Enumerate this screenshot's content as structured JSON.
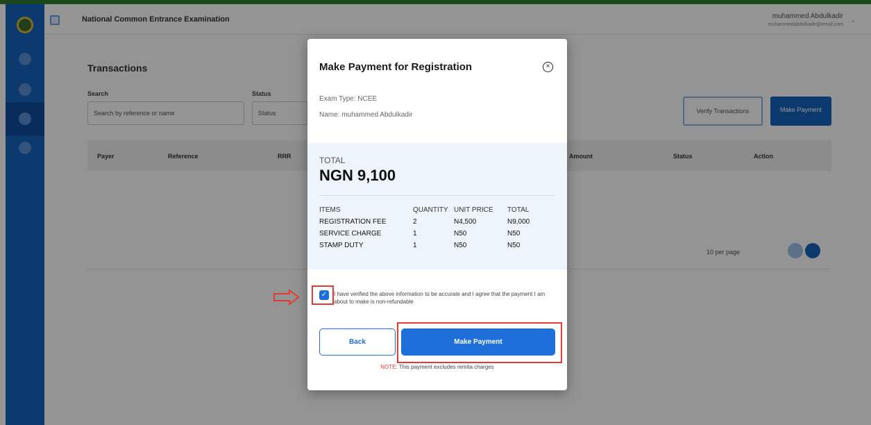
{
  "header": {
    "app_title": "National Common Entrance Examination",
    "user_name": "muhammed Abdulkadir",
    "user_email": "muhammedabdulkadir@email.com"
  },
  "page": {
    "title": "Transactions",
    "search_label": "Search",
    "search_placeholder": "Search by reference or name",
    "status_label": "Status",
    "status_value": "Status",
    "outline_button": "Verify Transactions",
    "primary_button": "Make Payment",
    "table_columns": [
      "Payer",
      "Reference",
      "RRR",
      "Amount",
      "Status",
      "Action"
    ],
    "per_page": "10 per page"
  },
  "modal": {
    "title": "Make Payment for Registration",
    "exam_type": "Exam Type: NCEE",
    "name": "Name: muhammed Abdulkadir",
    "total_label": "TOTAL",
    "total_amount": "NGN 9,100",
    "table_headers": [
      "ITEMS",
      "QUANTITY",
      "UNIT PRICE",
      "TOTAL"
    ],
    "items": [
      {
        "item": "REGISTRATION FEE",
        "quantity": "2",
        "unit_price": "N4,500",
        "total": "N9,000"
      },
      {
        "item": "SERVICE CHARGE",
        "quantity": "1",
        "unit_price": "N50",
        "total": "N50"
      },
      {
        "item": "STAMP DUTY",
        "quantity": "1",
        "unit_price": "N50",
        "total": "N50"
      }
    ],
    "agree_checked": true,
    "agree_text": "I have verified the above information to be accurate and I agree that the payment I am about to make is non-refundable",
    "back_label": "Back",
    "pay_label": "Make Payment",
    "note_label": "NOTE:",
    "note_text": " This payment excludes remita charges"
  },
  "colors": {
    "sidebar": "#1565c0",
    "primary": "#1e6fd9",
    "highlight": "#e53935"
  },
  "icons": [
    "close-icon",
    "check-icon",
    "arrow-right-icon",
    "search-icon",
    "chevron-down-icon"
  ]
}
